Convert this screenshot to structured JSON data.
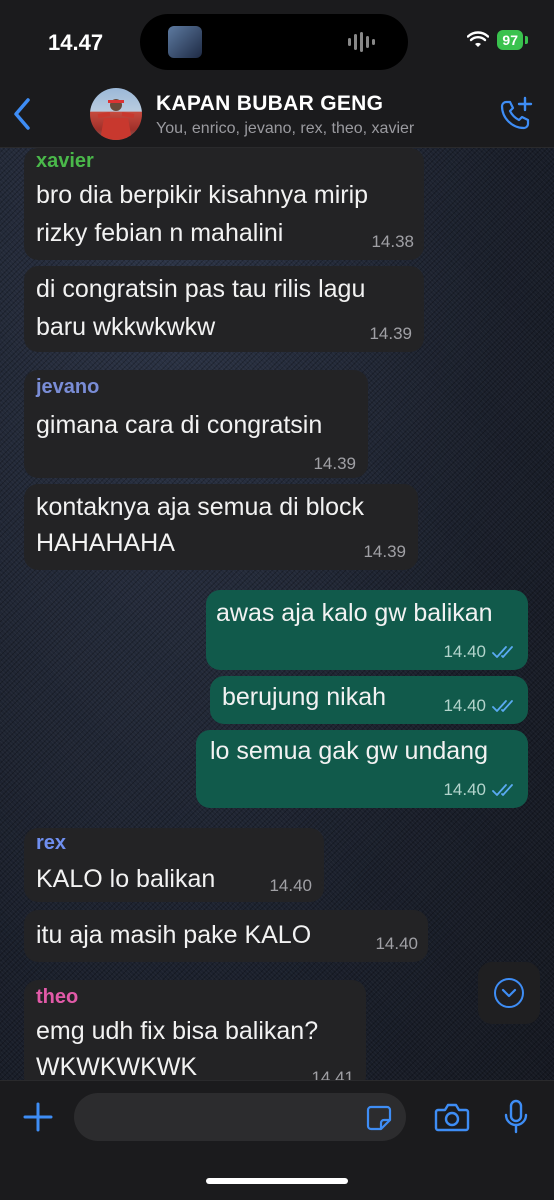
{
  "status_bar": {
    "time": "14.47",
    "battery": "97"
  },
  "header": {
    "title": "KAPAN BUBAR GENG",
    "members": "You, enrico, jevano, rex, theo, xavier"
  },
  "messages": [
    {
      "sender": "xavier",
      "lines": [
        "bro dia berpikir kisahnya mirip",
        "rizky febian n mahalini"
      ],
      "time": "14.38"
    },
    {
      "lines": [
        "di congratsin pas tau rilis lagu",
        "baru wkkwkwkw"
      ],
      "time": "14.39"
    },
    {
      "sender": "jevano",
      "lines": [
        "gimana cara di congratsin"
      ],
      "time": "14.39"
    },
    {
      "lines": [
        "kontaknya aja semua di block",
        "HAHAHAHA"
      ],
      "time": "14.39"
    },
    {
      "lines": [
        "awas aja kalo gw balikan"
      ],
      "time": "14.40"
    },
    {
      "lines": [
        "berujung nikah"
      ],
      "time": "14.40"
    },
    {
      "lines": [
        "lo semua gak gw undang"
      ],
      "time": "14.40"
    },
    {
      "sender": "rex",
      "lines": [
        "KALO lo balikan"
      ],
      "time": "14.40"
    },
    {
      "lines": [
        "itu aja masih pake KALO"
      ],
      "time": "14.40"
    },
    {
      "sender": "theo",
      "lines": [
        "emg udh fix bisa balikan?",
        "WKWKWKWK"
      ],
      "time": "14.41"
    }
  ],
  "input": {
    "placeholder": ""
  },
  "colors": {
    "outgoing_bubble": "#115a4b",
    "incoming_bubble": "#232325",
    "accent": "#3e8df5",
    "xavier": "#4ab84a",
    "jevano": "#7a8dd6",
    "rex": "#6f8ff0",
    "theo": "#e25aa8"
  },
  "icons": [
    "back-arrow-icon",
    "group-call-icon",
    "scroll-down-icon",
    "plus-icon",
    "sticker-icon",
    "camera-icon",
    "mic-icon",
    "double-check-icon"
  ]
}
